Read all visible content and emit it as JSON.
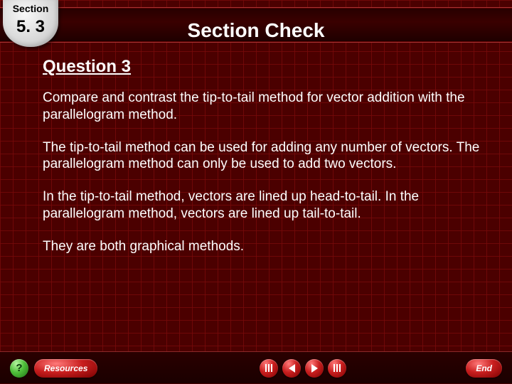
{
  "badge": {
    "section_label": "Section",
    "number": "5. 3"
  },
  "header": {
    "title": "Section Check"
  },
  "content": {
    "question_title": "Question 3",
    "p1": "Compare and contrast the tip-to-tail method for vector addition with the parallelogram method.",
    "p2": "The tip-to-tail method can be used for adding any number of vectors. The parallelogram method can only be used to add two vectors.",
    "p3": "In the tip-to-tail method, vectors are lined up head-to-tail. In the parallelogram method, vectors are lined up tail-to-tail.",
    "p4": "They are both graphical methods."
  },
  "nav": {
    "help": "?",
    "resources": "Resources",
    "end": "End"
  }
}
